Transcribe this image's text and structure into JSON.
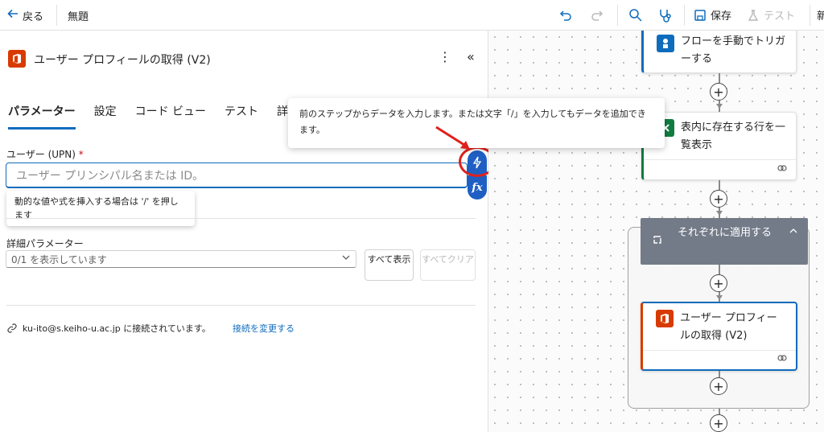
{
  "topbar": {
    "back_label": "戻る",
    "flow_title": "無題",
    "save_label": "保存",
    "test_label": "テスト",
    "overflow_label": "新"
  },
  "panel": {
    "title": "ユーザー プロフィールの取得 (V2)",
    "tabs": [
      {
        "label": "パラメーター",
        "active": true
      },
      {
        "label": "設定",
        "active": false
      },
      {
        "label": "コード ビュー",
        "active": false
      },
      {
        "label": "テスト",
        "active": false
      },
      {
        "label": "詳細",
        "active": false
      }
    ],
    "upn_label": "ユーザー (UPN)",
    "required_mark": "*",
    "upn_placeholder": "ユーザー プリンシパル名または ID。",
    "hint_text": "動的な値や式を挿入する場合は '/' を押します",
    "advanced_label": "詳細パラメーター",
    "advanced_value": "0/1 を表示しています",
    "show_all_label": "すべて表示",
    "clear_all_label": "すべてクリア",
    "connection_text": "ku-ito@s.keiho-u.ac.jp に接続されています。",
    "change_connection_label": "接続を変更する",
    "fx_label": "fx"
  },
  "tooltip": {
    "text": "前のステップからデータを入力します。または文字「/」を入力してもデータを追加できます。"
  },
  "canvas": {
    "cards": [
      {
        "label": "フローを手動でトリガーする",
        "icon": "manual-trigger-icon",
        "accent": "#0f6cbd"
      },
      {
        "label": "表内に存在する行を一覧表示",
        "icon": "excel-icon",
        "accent": "#107c41"
      },
      {
        "label": "ユーザー プロフィールの取得 (V2)",
        "icon": "office-icon",
        "accent": "#d83b01"
      }
    ],
    "foreach_label": "それぞれに適用する"
  },
  "colors": {
    "accent": "#0f6cbd",
    "highlight": "#e0201b",
    "office": "#d83b01",
    "excel": "#107c41",
    "foreach_header": "#737b88"
  }
}
